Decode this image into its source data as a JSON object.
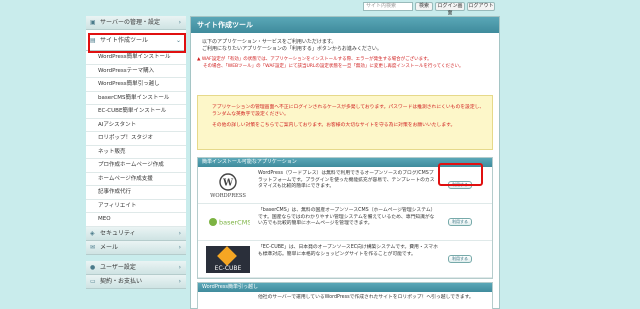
{
  "topbar": {
    "search_placeholder": "サイト内検索",
    "buttons": [
      "検索",
      "ログイン画面",
      "ログアウト"
    ]
  },
  "sidebar": {
    "categories_top": [
      {
        "label": "サーバーの管理・設定",
        "icon": "server-icon"
      },
      {
        "label": "サイト作成ツール",
        "icon": "tool-icon"
      }
    ],
    "items": [
      "WordPress簡単インストール",
      "WordPressテーマ購入",
      "WordPress簡単引っ越し",
      "baserCMS簡単インストール",
      "EC-CUBE簡単インストール",
      "AIアシスタント",
      "ロリポップ！スタジオ",
      "ネット販売",
      "プロ作成ホームページ作成",
      "ホームページ作成支援",
      "記事作成代行",
      "アフィリエイト",
      "MEO"
    ],
    "categories_bottom": [
      {
        "label": "セキュリティ",
        "icon": "shield-icon"
      },
      {
        "label": "メール",
        "icon": "mail-icon"
      },
      {
        "label": "ユーザー設定",
        "icon": "user-icon"
      },
      {
        "label": "契約・お支払い",
        "icon": "card-icon"
      }
    ]
  },
  "main": {
    "title": "サイト作成ツール",
    "intro_1": "以下のアプリケーション・サービスをご利用いただけます。",
    "intro_2": "ご利用になりたいアプリケーションの「利用する」ボタンからお進みください。",
    "warn_1": "▲ WAF設定が「有効」の状態では、アプリケーションをインストールする際、エラーが発生する場合がございます。",
    "warn_2": "その場合、「WEBツール」の「WAF設定」にて該当URLの設定状態を一旦「無効」に変更し再度インストールを行ってください。",
    "notice_1": "アプリケーションの管理画面へ不正にログインされるケースが多発しております。パスワードは推測されにくいものを設定し、ランダムな英数字で設定ください。",
    "notice_2": "その他の詳しい対策をこちらでご案内しております。お客様の大切なサイトを守る為に対策をお願いいたします。",
    "section1_title": "簡単インストール可能なアプリケーション",
    "apps": [
      {
        "logo": "WORDPRESS",
        "desc": "WordPress（ワードプレス）は無料で利用できるオープンソースのブログ/CMSプラットフォームです。プラグインを使った機能拡充が容易で、テンプレートのカスタマイズも比較的簡単にできます。",
        "button": "利用する"
      },
      {
        "logo": "baserCMS",
        "desc": "「baserCMS」は、無料の国産オープンソースCMS（ホームページ管理システム）です。国産ならではのわかりやすい管理システムを備えているため、専門知識がない方でも比較的簡単にホームページを管理できます。",
        "button": "利用する"
      },
      {
        "logo": "EC-CUBE",
        "desc": "「EC-CUBE」は、日本発のオープンソースEC向け構築システムです。費用・スマホも標準対応。簡単に本格的なショッピングサイトを作ることが可能です。",
        "button": "利用する"
      }
    ],
    "section2_title": "WordPress簡単引っ越し",
    "section2_desc": "他社のサーバーで運用しているWordPressで作成されたサイトをロリポップ！へ引っ越しできます。"
  },
  "colors": {
    "accent": "#3f8b9c",
    "highlight": "#e01010",
    "warn": "#d02020",
    "bg": "#c9ecec"
  }
}
